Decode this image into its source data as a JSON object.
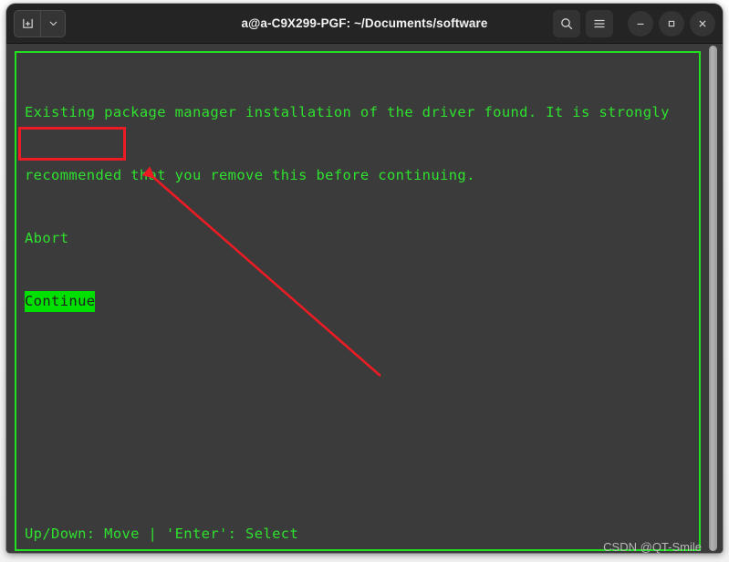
{
  "window": {
    "title": "a@a-C9X299-PGF: ~/Documents/software"
  },
  "titlebar": {
    "new_tab_label": "new-tab",
    "dropdown_label": "tab-menu",
    "search_label": "search",
    "menu_label": "menu",
    "minimize_label": "–",
    "maximize_label": "▫",
    "close_label": "✕"
  },
  "terminal": {
    "message_line1": "Existing package manager installation of the driver found. It is strongly",
    "message_line2": "recommended that you remove this before continuing.",
    "menu": [
      {
        "label": "Abort",
        "selected": false
      },
      {
        "label": "Continue",
        "selected": true
      }
    ],
    "footer": "Up/Down: Move | 'Enter': Select"
  },
  "annotation": {
    "highlight_target": "Continue",
    "arrow_color": "#ed1c24",
    "box_color": "#ed1c24"
  },
  "watermark": {
    "text": "CSDN @QT-Smile"
  },
  "colors": {
    "terminal_bg": "#3b3b3b",
    "terminal_fg": "#2fe02f",
    "selection_bg": "#00e000",
    "selection_fg": "#1f1f1f",
    "titlebar_bg": "#242424"
  }
}
